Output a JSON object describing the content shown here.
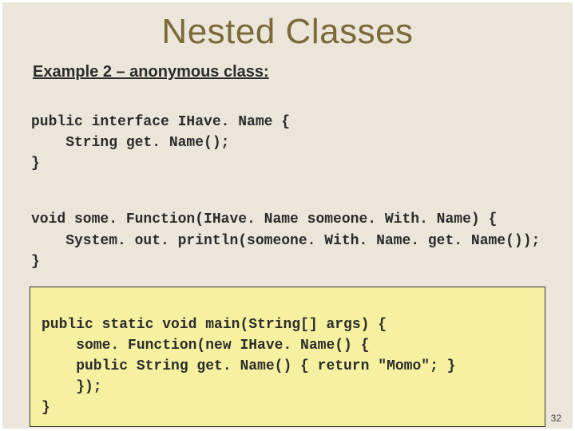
{
  "slide": {
    "title": "Nested Classes",
    "subtitle": "Example 2 – anonymous class:",
    "page_number": "32"
  },
  "code": {
    "block1": {
      "l1": "public interface IHave. Name {",
      "l2": "    String get. Name();",
      "l3": "}"
    },
    "block2": {
      "l1": "void some. Function(IHave. Name someone. With. Name) {",
      "l2": "    System. out. println(someone. With. Name. get. Name());",
      "l3": "}"
    },
    "block3": {
      "l1": "public static void main(String[] args) {",
      "l2": "    some. Function(new IHave. Name() {",
      "l3": "    public String get. Name() { return \"Momo\"; }",
      "l4": "    });",
      "l5": "}"
    }
  }
}
